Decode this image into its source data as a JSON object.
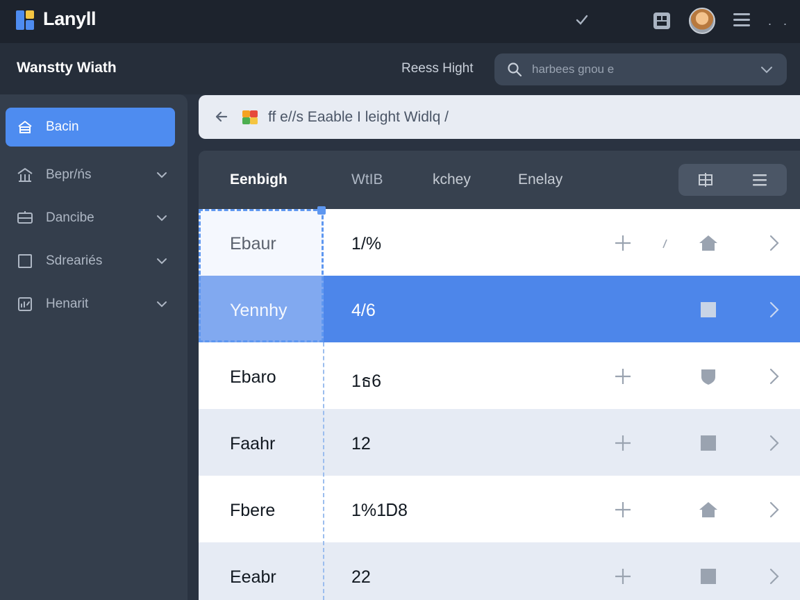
{
  "app": {
    "name": "Lanyll",
    "brand_colors": [
      "#4e8cf0",
      "#f4c542"
    ]
  },
  "topbar": {
    "icons": [
      "check-icon",
      "grid-box-icon",
      "avatar",
      "menu-icon",
      "more-dots-icon"
    ],
    "more_dots": ". ."
  },
  "header": {
    "page_title": "Wanstty Wiath",
    "link": "Reess Hight",
    "search": {
      "placeholder": "harbees gnou e"
    }
  },
  "sidebar": {
    "items": [
      {
        "label": "Bacin",
        "icon": "home-icon",
        "active": true
      },
      {
        "label": "Bepr/ńs",
        "icon": "bank-icon",
        "active": false
      },
      {
        "label": "Dancibe",
        "icon": "device-icon",
        "active": false
      },
      {
        "label": "Sdreariés",
        "icon": "square-icon",
        "active": false
      },
      {
        "label": "Henarit",
        "icon": "chart-icon",
        "active": false
      }
    ],
    "accent": "#4e8cf0"
  },
  "breadcrumb": {
    "text": "ff e//s Eaable I leight Widlq /"
  },
  "table": {
    "columns": [
      "Eenbigh",
      "WtIB",
      "kchey",
      "Enelay"
    ],
    "rows": [
      {
        "name": "Ebaur",
        "value": "1/%",
        "icon": "home-icon",
        "style": "white",
        "selected": false
      },
      {
        "name": "Yennhy",
        "value": "4/6",
        "icon": "square-icon",
        "style": "sel",
        "selected": true
      },
      {
        "name": "Ebaro",
        "value": "1ธ6",
        "icon": "shield-icon",
        "style": "white",
        "selected": false
      },
      {
        "name": "Faahr",
        "value": "12",
        "icon": "square-icon",
        "style": "gray",
        "selected": false
      },
      {
        "name": "Fbere",
        "value": "1%1Ꭰ8",
        "icon": "home-icon",
        "style": "white",
        "selected": false
      },
      {
        "name": "Eeabr",
        "value": "22",
        "icon": "square-icon",
        "style": "gray",
        "selected": false
      }
    ],
    "view_toggle": [
      "columns-icon",
      "list-icon"
    ],
    "selected_color": "#4d86ea"
  }
}
